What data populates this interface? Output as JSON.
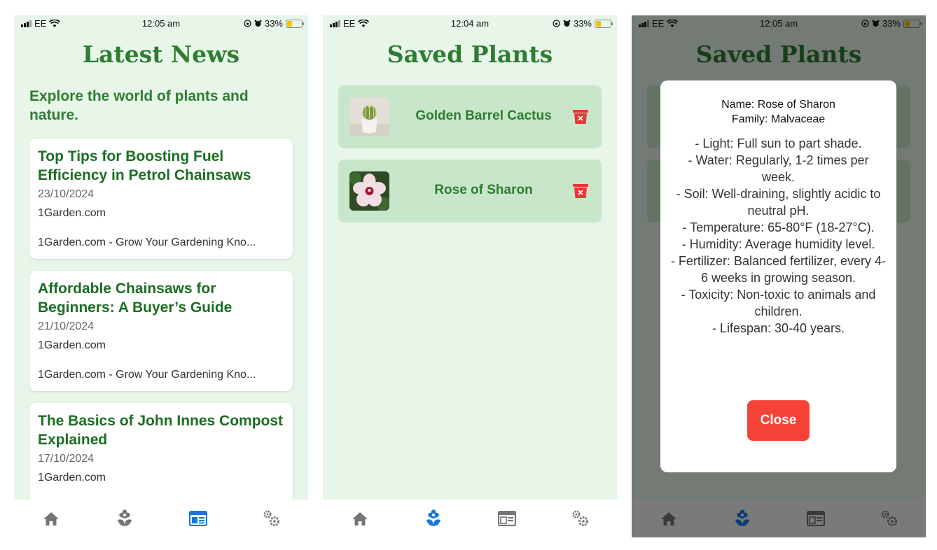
{
  "colors": {
    "primary_green": "#2e7d32",
    "active_tab": "#1976d2",
    "delete_red": "#e53935",
    "close_red": "#f44336"
  },
  "screens": [
    {
      "status": {
        "carrier": "EE",
        "time": "12:05 am",
        "battery": "33%",
        "battery_level": 0.33
      },
      "title": "Latest News",
      "subtitle": "Explore the world of plants and nature.",
      "news": [
        {
          "title": "Top Tips for Boosting Fuel Efficiency in Petrol Chainsaws",
          "date": "23/10/2024",
          "source": "1Garden.com",
          "description": "1Garden.com - Grow Your Gardening Kno..."
        },
        {
          "title": "Affordable Chainsaws for Beginners: A Buyer’s Guide",
          "date": "21/10/2024",
          "source": "1Garden.com",
          "description": "1Garden.com - Grow Your Gardening Kno..."
        },
        {
          "title": "The Basics of John Innes Compost Explained",
          "date": "17/10/2024",
          "source": "1Garden.com"
        }
      ],
      "tabs": [
        {
          "icon": "home-icon",
          "active": false
        },
        {
          "icon": "plant-icon",
          "active": false
        },
        {
          "icon": "news-icon",
          "active": true
        },
        {
          "icon": "settings-icon",
          "active": false
        }
      ]
    },
    {
      "status": {
        "carrier": "EE",
        "time": "12:04 am",
        "battery": "33%",
        "battery_level": 0.33
      },
      "title": "Saved Plants",
      "plants": [
        {
          "name": "Golden Barrel Cactus",
          "icon": "cactus-image"
        },
        {
          "name": "Rose of Sharon",
          "icon": "hibiscus-flower-image"
        }
      ],
      "tabs": [
        {
          "icon": "home-icon",
          "active": false
        },
        {
          "icon": "plant-icon",
          "active": true
        },
        {
          "icon": "news-icon",
          "active": false
        },
        {
          "icon": "settings-icon",
          "active": false
        }
      ]
    },
    {
      "status": {
        "carrier": "EE",
        "time": "12:05 am",
        "battery": "33%",
        "battery_level": 0.33
      },
      "title": "Saved Plants",
      "modal": {
        "name": "Name: Rose of Sharon",
        "family": "Family: Malvaceae",
        "details": [
          "- Light: Full sun to part shade.",
          "- Water: Regularly, 1-2 times per week.",
          "- Soil: Well-draining, slightly acidic to neutral pH.",
          "- Temperature: 65-80°F (18-27°C).",
          "- Humidity: Average humidity level.",
          "- Fertilizer: Balanced fertilizer, every 4-6 weeks in growing season.",
          "- Toxicity: Non-toxic to animals and children.",
          "- Lifespan: 30-40 years."
        ],
        "close_label": "Close"
      },
      "tabs": [
        {
          "icon": "home-icon",
          "active": false
        },
        {
          "icon": "plant-icon",
          "active": true
        },
        {
          "icon": "news-icon",
          "active": false
        },
        {
          "icon": "settings-icon",
          "active": false
        }
      ]
    }
  ]
}
